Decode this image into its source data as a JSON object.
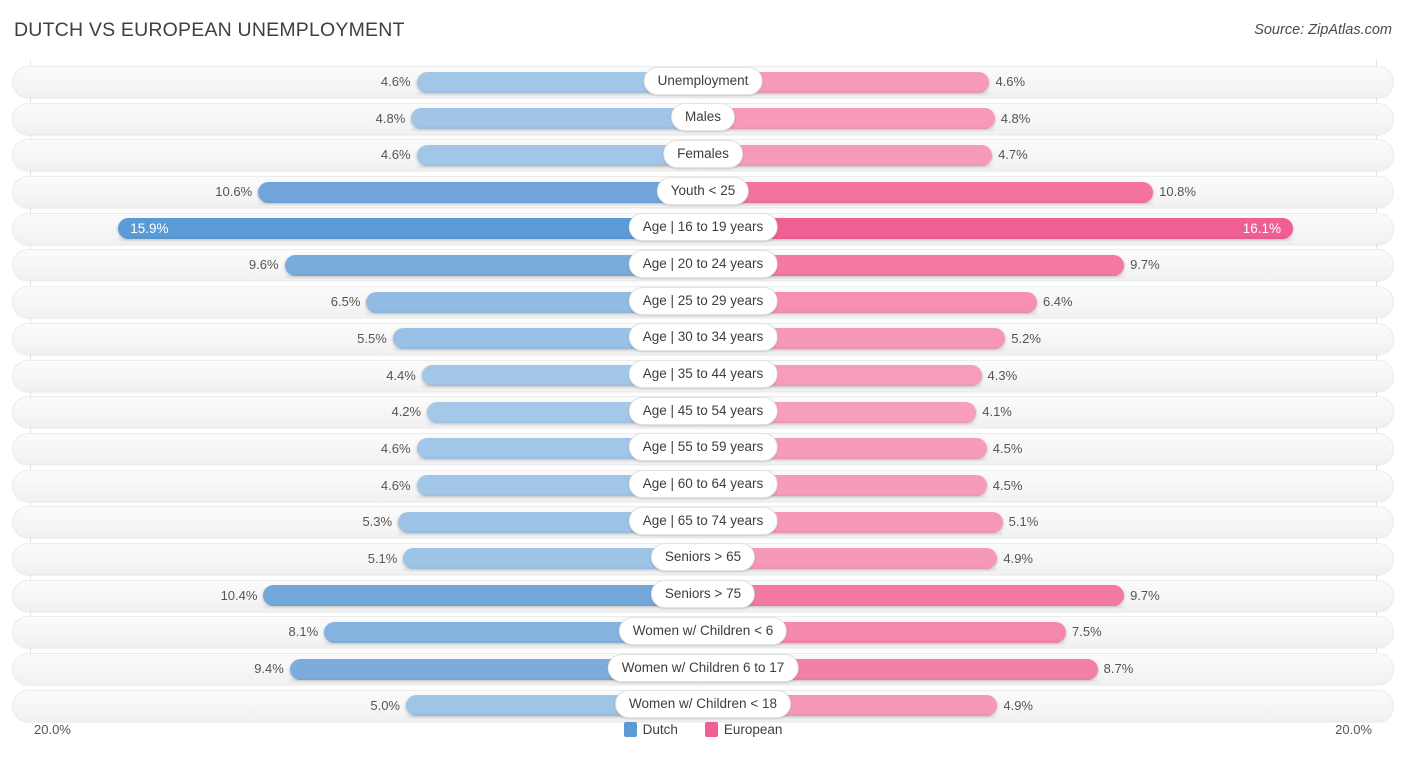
{
  "header": {
    "title": "DUTCH VS EUROPEAN UNEMPLOYMENT",
    "source": "Source: ZipAtlas.com"
  },
  "legend": {
    "dutch_label": "Dutch",
    "european_label": "European",
    "dutch_color": "#5b9bd5",
    "european_color": "#ef5f93"
  },
  "axis": {
    "left": "20.0%",
    "right": "20.0%",
    "max": 20.0
  },
  "chart_data": {
    "type": "bar",
    "title": "DUTCH VS EUROPEAN UNEMPLOYMENT",
    "subtitle": "Source: ZipAtlas.com",
    "orientation": "horizontal-diverging",
    "xlabel": "",
    "ylabel": "",
    "xlim": [
      20.0,
      20.0
    ],
    "grid": true,
    "legend_position": "bottom-center",
    "categories": [
      "Unemployment",
      "Males",
      "Females",
      "Youth < 25",
      "Age | 16 to 19 years",
      "Age | 20 to 24 years",
      "Age | 25 to 29 years",
      "Age | 30 to 34 years",
      "Age | 35 to 44 years",
      "Age | 45 to 54 years",
      "Age | 55 to 59 years",
      "Age | 60 to 64 years",
      "Age | 65 to 74 years",
      "Seniors > 65",
      "Seniors > 75",
      "Women w/ Children < 6",
      "Women w/ Children 6 to 17",
      "Women w/ Children < 18"
    ],
    "series": [
      {
        "name": "Dutch",
        "color": "#5b9bd5",
        "values": [
          4.6,
          4.8,
          4.6,
          10.6,
          15.9,
          9.6,
          6.5,
          5.5,
          4.4,
          4.2,
          4.6,
          4.6,
          5.3,
          5.1,
          10.4,
          8.1,
          9.4,
          5.0
        ],
        "labels": [
          "4.6%",
          "4.8%",
          "4.6%",
          "10.6%",
          "15.9%",
          "9.6%",
          "6.5%",
          "5.5%",
          "4.4%",
          "4.2%",
          "4.6%",
          "4.6%",
          "5.3%",
          "5.1%",
          "10.4%",
          "8.1%",
          "9.4%",
          "5.0%"
        ]
      },
      {
        "name": "European",
        "color": "#ef5f93",
        "values": [
          4.6,
          4.8,
          4.7,
          10.8,
          16.1,
          9.7,
          6.4,
          5.2,
          4.3,
          4.1,
          4.5,
          4.5,
          5.1,
          4.9,
          9.7,
          7.5,
          8.7,
          4.9
        ],
        "labels": [
          "4.6%",
          "4.8%",
          "4.7%",
          "10.8%",
          "16.1%",
          "9.7%",
          "6.4%",
          "5.2%",
          "4.3%",
          "4.1%",
          "4.5%",
          "4.5%",
          "5.1%",
          "4.9%",
          "9.7%",
          "7.5%",
          "8.7%",
          "4.9%"
        ]
      }
    ]
  },
  "rows": [
    {
      "label": "Unemployment",
      "left": "4.6%",
      "right": "4.6%",
      "lv": 4.6,
      "rv": 4.6,
      "hl": false
    },
    {
      "label": "Males",
      "left": "4.8%",
      "right": "4.8%",
      "lv": 4.8,
      "rv": 4.8,
      "hl": false
    },
    {
      "label": "Females",
      "left": "4.6%",
      "right": "4.7%",
      "lv": 4.6,
      "rv": 4.7,
      "hl": false
    },
    {
      "label": "Youth < 25",
      "left": "10.6%",
      "right": "10.8%",
      "lv": 10.6,
      "rv": 10.8,
      "hl": false
    },
    {
      "label": "Age | 16 to 19 years",
      "left": "15.9%",
      "right": "16.1%",
      "lv": 15.9,
      "rv": 16.1,
      "hl": true
    },
    {
      "label": "Age | 20 to 24 years",
      "left": "9.6%",
      "right": "9.7%",
      "lv": 9.6,
      "rv": 9.7,
      "hl": false
    },
    {
      "label": "Age | 25 to 29 years",
      "left": "6.5%",
      "right": "6.4%",
      "lv": 6.5,
      "rv": 6.4,
      "hl": false
    },
    {
      "label": "Age | 30 to 34 years",
      "left": "5.5%",
      "right": "5.2%",
      "lv": 5.5,
      "rv": 5.2,
      "hl": false
    },
    {
      "label": "Age | 35 to 44 years",
      "left": "4.4%",
      "right": "4.3%",
      "lv": 4.4,
      "rv": 4.3,
      "hl": false
    },
    {
      "label": "Age | 45 to 54 years",
      "left": "4.2%",
      "right": "4.1%",
      "lv": 4.2,
      "rv": 4.1,
      "hl": false
    },
    {
      "label": "Age | 55 to 59 years",
      "left": "4.6%",
      "right": "4.5%",
      "lv": 4.6,
      "rv": 4.5,
      "hl": false
    },
    {
      "label": "Age | 60 to 64 years",
      "left": "4.6%",
      "right": "4.5%",
      "lv": 4.6,
      "rv": 4.5,
      "hl": false
    },
    {
      "label": "Age | 65 to 74 years",
      "left": "5.3%",
      "right": "5.1%",
      "lv": 5.3,
      "rv": 5.1,
      "hl": false
    },
    {
      "label": "Seniors > 65",
      "left": "5.1%",
      "right": "4.9%",
      "lv": 5.1,
      "rv": 4.9,
      "hl": false
    },
    {
      "label": "Seniors > 75",
      "left": "10.4%",
      "right": "9.7%",
      "lv": 10.4,
      "rv": 9.7,
      "hl": false
    },
    {
      "label": "Women w/ Children < 6",
      "left": "8.1%",
      "right": "7.5%",
      "lv": 8.1,
      "rv": 7.5,
      "hl": false
    },
    {
      "label": "Women w/ Children 6 to 17",
      "left": "9.4%",
      "right": "8.7%",
      "lv": 9.4,
      "rv": 8.7,
      "hl": false
    },
    {
      "label": "Women w/ Children < 18",
      "left": "5.0%",
      "right": "4.9%",
      "lv": 5.0,
      "rv": 4.9,
      "hl": false
    }
  ]
}
